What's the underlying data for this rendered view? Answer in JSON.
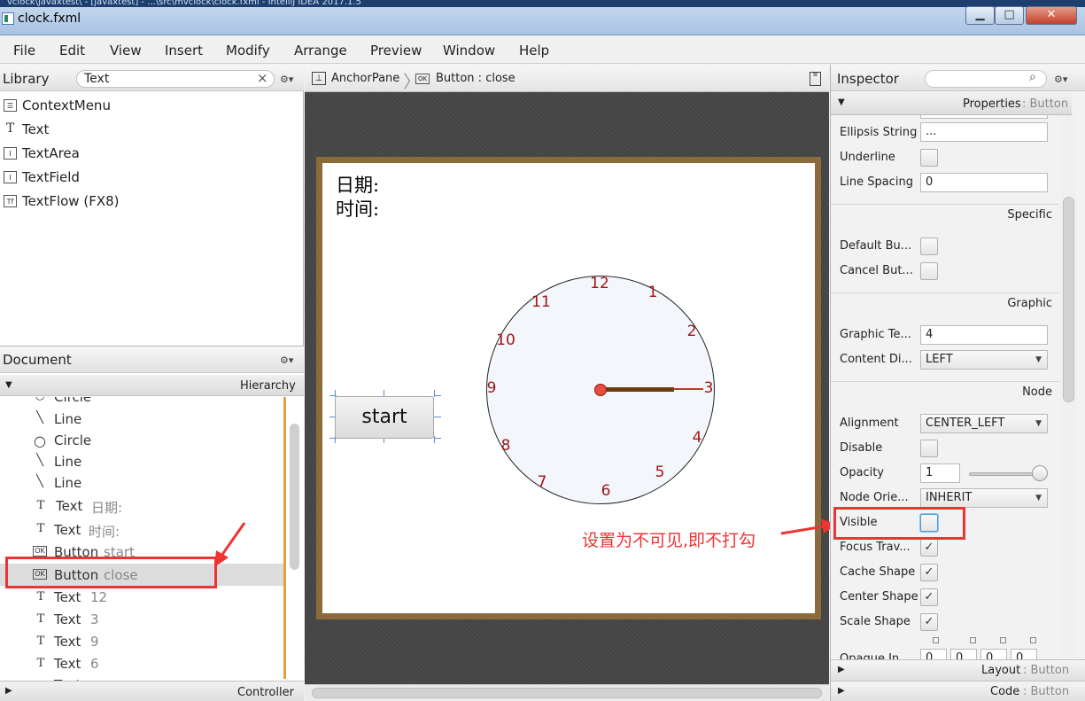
{
  "window": {
    "title": "clock.fxml",
    "path_strip": "vclock\\javaxtest\\ - [javaxtest] - ...\\src\\mvclock\\clock.fxml - IntelliJ IDEA 2017.1.5",
    "min": "▁",
    "max": "□",
    "close": "✕"
  },
  "menu": [
    "File",
    "Edit",
    "View",
    "Insert",
    "Modify",
    "Arrange",
    "Preview",
    "Window",
    "Help"
  ],
  "library": {
    "title": "Library",
    "search": "Text",
    "clear": "×",
    "gear": "⚙▾",
    "items": [
      {
        "label": "ContextMenu",
        "icon": "context-menu-icon"
      },
      {
        "label": "Text",
        "icon": "text-icon"
      },
      {
        "label": "TextArea",
        "icon": "textarea-icon"
      },
      {
        "label": "TextField",
        "icon": "textfield-icon"
      },
      {
        "label": "TextFlow  (FX8)",
        "icon": "textflow-icon"
      }
    ]
  },
  "document": {
    "title": "Document",
    "gear": "⚙▾",
    "hierarchy": "Hierarchy",
    "controller": "Controller",
    "items": [
      {
        "type": "Circle",
        "sub": ""
      },
      {
        "type": "Line",
        "sub": ""
      },
      {
        "type": "Circle",
        "sub": ""
      },
      {
        "type": "Line",
        "sub": ""
      },
      {
        "type": "Line",
        "sub": ""
      },
      {
        "type": "Text",
        "sub": "日期:"
      },
      {
        "type": "Text",
        "sub": "时间:"
      },
      {
        "type": "Button",
        "sub": "start"
      },
      {
        "type": "Button",
        "sub": "close"
      },
      {
        "type": "Text",
        "sub": "12"
      },
      {
        "type": "Text",
        "sub": "3"
      },
      {
        "type": "Text",
        "sub": "9"
      },
      {
        "type": "Text",
        "sub": "6"
      },
      {
        "type": "Text",
        "sub": "..."
      }
    ]
  },
  "breadcrumb": {
    "root": "AnchorPane",
    "current": "Button : close"
  },
  "canvas": {
    "date_label": "日期:",
    "time_label": "时间:",
    "start_button": "start",
    "clock_numbers": [
      "12",
      "1",
      "2",
      "3",
      "4",
      "5",
      "6",
      "7",
      "8",
      "9",
      "10",
      "11"
    ]
  },
  "annotation": "设置为不可见,即不打勾",
  "inspector": {
    "title": "Inspector",
    "gear": "⚙▾",
    "search_icon": "⌕",
    "properties_bar": "Properties",
    "properties_target": "Button",
    "sections": {
      "specific": "Specific",
      "graphic": "Graphic",
      "node": "Node"
    },
    "props": {
      "ellipsis_label": "Ellipsis String",
      "ellipsis_value": "...",
      "underline_label": "Underline",
      "line_spacing_label": "Line Spacing",
      "line_spacing_value": "0",
      "default_label": "Default Bu...",
      "cancel_label": "Cancel But...",
      "graphic_text_label": "Graphic Te...",
      "graphic_text_value": "4",
      "content_display_label": "Content Di...",
      "content_display_value": "LEFT",
      "alignment_label": "Alignment",
      "alignment_value": "CENTER_LEFT",
      "disable_label": "Disable",
      "opacity_label": "Opacity",
      "opacity_value": "1",
      "node_orient_label": "Node Orie...",
      "node_orient_value": "INHERIT",
      "visible_label": "Visible",
      "focus_label": "Focus Trav...",
      "cache_label": "Cache Shape",
      "center_label": "Center Shape",
      "scale_label": "Scale Shape",
      "opaque_label": "Opaque In...",
      "opaque_values": [
        "0",
        "0",
        "0",
        "0"
      ]
    },
    "layout_bar": "Layout",
    "code_bar": "Code",
    "target": "Button"
  },
  "checkbox_states": {
    "underline": false,
    "default": false,
    "cancel": false,
    "disable": false,
    "visible": false,
    "focus": true,
    "cache": true,
    "center": true,
    "scale": true
  },
  "colors": {
    "accent_red": "#e33333",
    "clock_number": "#a01818",
    "frame": "#8b6b3a"
  }
}
